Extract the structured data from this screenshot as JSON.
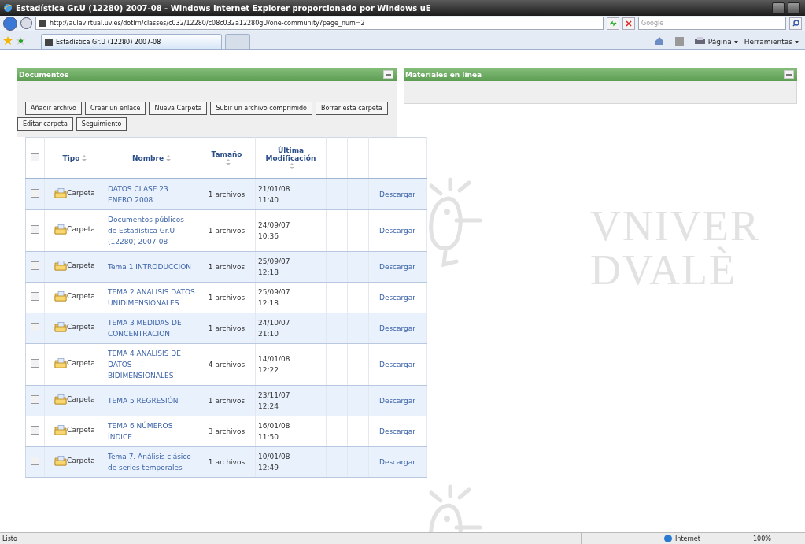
{
  "window": {
    "title": "Estadística Gr.U (12280) 2007-08 - Windows Internet Explorer proporcionado por Windows uE"
  },
  "address_bar": {
    "url": "http://aulavirtual.uv.es/dotlrn/classes/c032/12280/c08c032a12280gU/one-community?page_num=2",
    "search_placeholder": "Google"
  },
  "tabs": [
    {
      "label": "Estadística Gr.U (12280) 2007-08",
      "selected": true
    }
  ],
  "command_bar": [
    "Página",
    "Herramientas"
  ],
  "background_logo": {
    "line_1": "VNIVER",
    "line_2": "DVALÈ"
  },
  "documents_panel": {
    "title": "Documentos",
    "buttons": [
      "Añadir archivo",
      "Crear un enlace",
      "Nueva Carpeta",
      "Subir un archivo comprimido",
      "Borrar esta carpeta",
      "Editar carpeta",
      "Seguimiento"
    ],
    "table": {
      "select_all_checked": false,
      "columns": [
        {
          "label": "Tipo",
          "sortable": true
        },
        {
          "label": "Nombre",
          "sortable": true
        },
        {
          "label": "Tamaño",
          "sortable": true
        },
        {
          "label": "Última Modificación",
          "sortable": true
        }
      ],
      "rows": [
        {
          "checked": false,
          "type": "Carpeta",
          "name": "DATOS CLASE 23 ENERO 2008",
          "size": "1 archivos",
          "date": "21/01/08",
          "time": "11:40",
          "action": "Descargar"
        },
        {
          "checked": false,
          "type": "Carpeta",
          "name": "Documentos públicos de Estadística Gr.U (12280) 2007-08",
          "size": "1 archivos",
          "date": "24/09/07",
          "time": "10:36",
          "action": "Descargar"
        },
        {
          "checked": false,
          "type": "Carpeta",
          "name": "Tema 1 INTRODUCCION",
          "size": "1 archivos",
          "date": "25/09/07",
          "time": "12:18",
          "action": "Descargar"
        },
        {
          "checked": false,
          "type": "Carpeta",
          "name": "TEMA 2 ANALISIS DATOS UNIDIMENSIONALES",
          "size": "1 archivos",
          "date": "25/09/07",
          "time": "12:18",
          "action": "Descargar"
        },
        {
          "checked": false,
          "type": "Carpeta",
          "name": "TEMA 3 MEDIDAS DE CONCENTRACION",
          "size": "1 archivos",
          "date": "24/10/07",
          "time": "21:10",
          "action": "Descargar"
        },
        {
          "checked": false,
          "type": "Carpeta",
          "name": "TEMA 4 ANALISIS DE DATOS BIDIMENSIONALES",
          "size": "4 archivos",
          "date": "14/01/08",
          "time": "12:22",
          "action": "Descargar"
        },
        {
          "checked": false,
          "type": "Carpeta",
          "name": "TEMA 5 REGRESIÓN",
          "size": "1 archivos",
          "date": "23/11/07",
          "time": "12:24",
          "action": "Descargar"
        },
        {
          "checked": false,
          "type": "Carpeta",
          "name": "TEMA 6 NÚMEROS ÍNDICE",
          "size": "3 archivos",
          "date": "16/01/08",
          "time": "11:50",
          "action": "Descargar"
        },
        {
          "checked": false,
          "type": "Carpeta",
          "name": "Tema 7. Análisis clásico de series temporales",
          "size": "1 archivos",
          "date": "10/01/08",
          "time": "12:49",
          "action": "Descargar"
        }
      ]
    }
  },
  "materials_panel": {
    "title": "Materiales en línea"
  },
  "status_bar": {
    "text": "Listo",
    "zone": "Internet",
    "zoom": "100%"
  }
}
